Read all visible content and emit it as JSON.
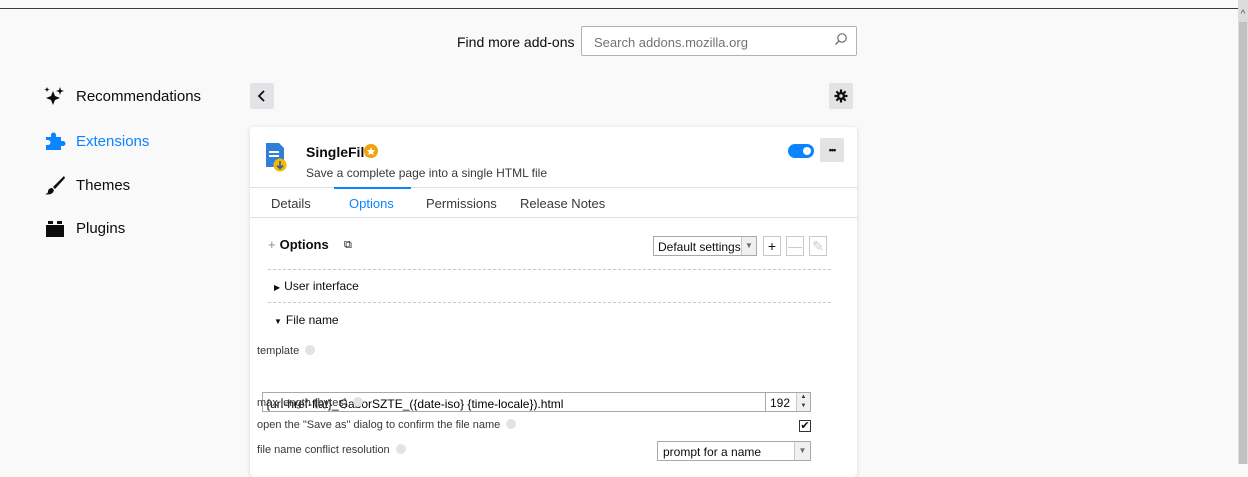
{
  "search": {
    "label": "Find more add-ons",
    "placeholder": "Search addons.mozilla.org"
  },
  "sidebar": {
    "items": [
      {
        "label": "Recommendations",
        "icon": "sparkle-icon",
        "active": false
      },
      {
        "label": "Extensions",
        "icon": "puzzle-icon",
        "active": true
      },
      {
        "label": "Themes",
        "icon": "brush-icon",
        "active": false
      },
      {
        "label": "Plugins",
        "icon": "plugin-icon",
        "active": false
      }
    ]
  },
  "addon": {
    "name": "SingleFile",
    "description": "Save a complete page into a single HTML file",
    "enabled": true,
    "more_label": "•••"
  },
  "tabs": [
    {
      "label": "Details",
      "active": false
    },
    {
      "label": "Options",
      "active": true
    },
    {
      "label": "Permissions",
      "active": false
    },
    {
      "label": "Release Notes",
      "active": false
    }
  ],
  "options": {
    "plus": "+",
    "title": "Options",
    "external_link": "⧉",
    "profile": "Default settings",
    "add_btn": "+",
    "remove_btn": "—",
    "edit_btn": "✎",
    "sections": {
      "user_interface": "User interface",
      "file_name": "File name"
    },
    "fields": {
      "template_label": "template",
      "template_value": "{url-href-flat}_GaborSZTE_({date-iso} {time-locale}).html",
      "max_length_label": "max length (bytes)",
      "max_length_value": "192",
      "save_as_label": "open the \"Save as\" dialog to confirm the file name",
      "save_as_checked": true,
      "check_mark": "✔",
      "conflict_label": "file name conflict resolution",
      "conflict_value": "prompt for a name"
    }
  },
  "colors": {
    "accent": "#0a84ff",
    "badge": "#f0a30a",
    "background": "#f9f9fa"
  }
}
